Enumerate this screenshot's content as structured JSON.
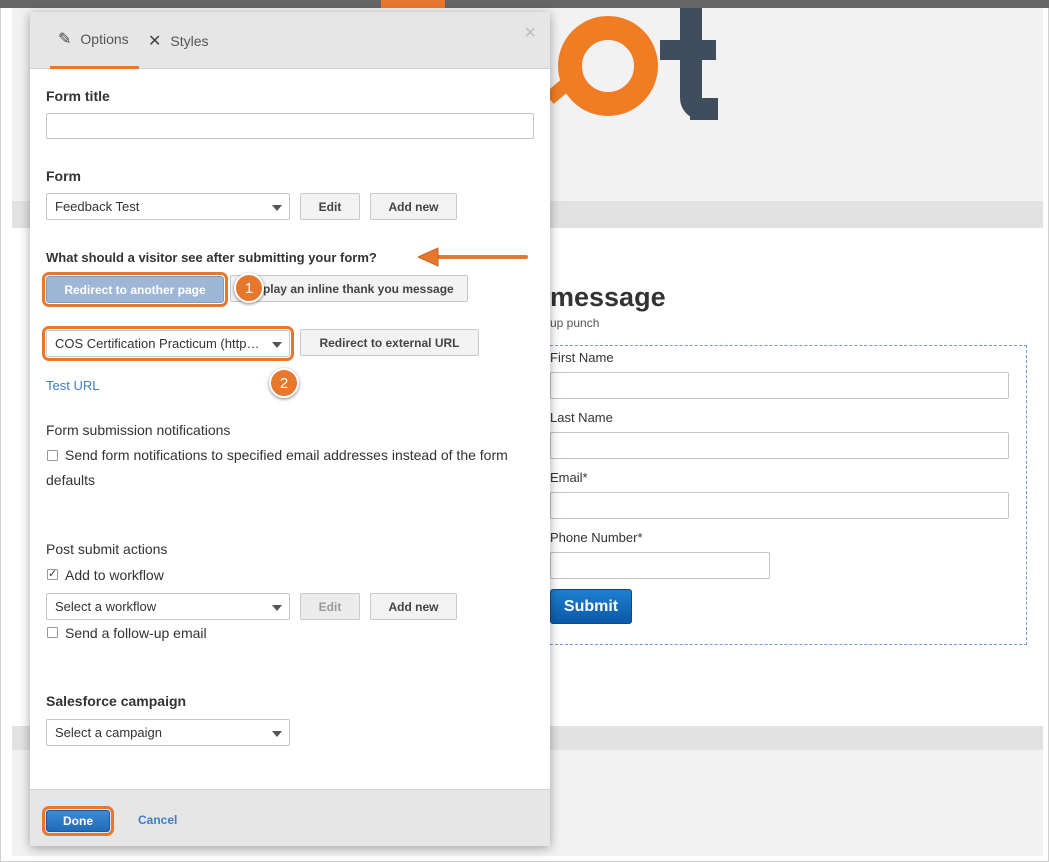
{
  "modal": {
    "tabs": [
      {
        "label": "Options",
        "icon": "pencil-icon"
      },
      {
        "label": "Styles",
        "icon": "scissors-icon"
      }
    ],
    "close_glyph": "×",
    "form_title_label": "Form title",
    "form_title_value": "",
    "form_label": "Form",
    "form_select_value": "Feedback Test",
    "form_edit_label": "Edit",
    "form_add_new_label": "Add new",
    "visitor_question": "What should a visitor see after submitting your form?",
    "redirect_page_label": "Redirect to another page",
    "inline_thanks_label": "Display an inline thank you message",
    "page_select_value": "COS Certification Practicum (http…",
    "redirect_external_label": "Redirect to external URL",
    "test_url_label": "Test URL",
    "notifications_label": "Form submission notifications",
    "notifications_checkbox_label": "Send form notifications to specified email addresses instead of the form defaults",
    "post_submit_label": "Post submit actions",
    "add_workflow_label": "Add to workflow",
    "workflow_select_placeholder": "Select a workflow",
    "workflow_edit_label": "Edit",
    "workflow_add_new_label": "Add new",
    "followup_email_label": "Send a follow-up email",
    "salesforce_label": "Salesforce campaign",
    "campaign_select_placeholder": "Select a campaign",
    "done_label": "Done",
    "cancel_label": "Cancel"
  },
  "annotations": {
    "badge_1": "1",
    "badge_2": "2"
  },
  "background_page": {
    "heading": "message",
    "subheading": "up punch",
    "fields": [
      {
        "label": "First Name"
      },
      {
        "label": "Last Name"
      },
      {
        "label": "Email*"
      },
      {
        "label": "Phone Number*"
      }
    ],
    "submit_label": "Submit"
  },
  "colors": {
    "accent_orange": "#e8772e",
    "link_blue": "#3a80c7",
    "submit_blue": "#0a5aa8",
    "logo_slate": "#3f4d5c"
  }
}
